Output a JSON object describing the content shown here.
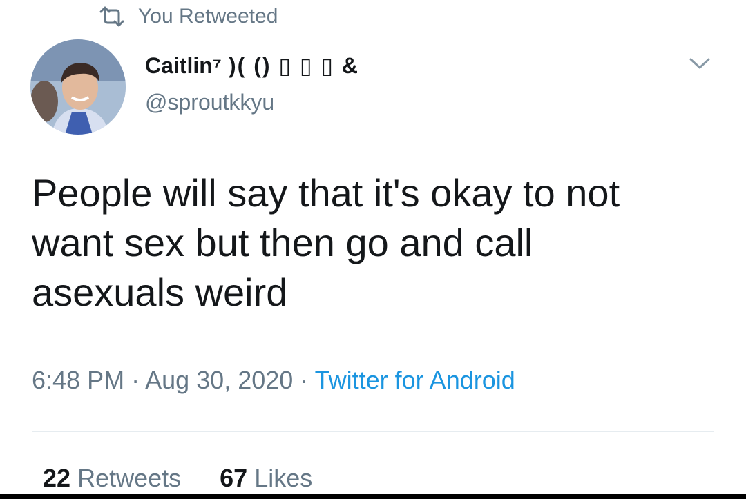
{
  "retweet_banner": {
    "icon": "retweet-icon",
    "text": "You Retweeted"
  },
  "author": {
    "display_name": "Caitlin⁷",
    "name_suffix": ")( () ▯ ▯ ▯ &",
    "handle": "@sproutkkyu",
    "avatar": "avatar"
  },
  "menu": {
    "icon": "chevron-down-icon"
  },
  "tweet": {
    "text": "People will say that it's okay to not\nwant sex but then go and call\nasexuals weird"
  },
  "meta": {
    "time": "6:48 PM",
    "sep1": " · ",
    "date": "Aug 30, 2020",
    "sep2": " · ",
    "source": "Twitter for Android"
  },
  "stats": {
    "retweets_count": "22",
    "retweets_label": "Retweets",
    "likes_count": "67",
    "likes_label": "Likes"
  },
  "colors": {
    "text": "#14171a",
    "secondary": "#657786",
    "link": "#1b95e0",
    "divider": "#e6ecf0"
  }
}
